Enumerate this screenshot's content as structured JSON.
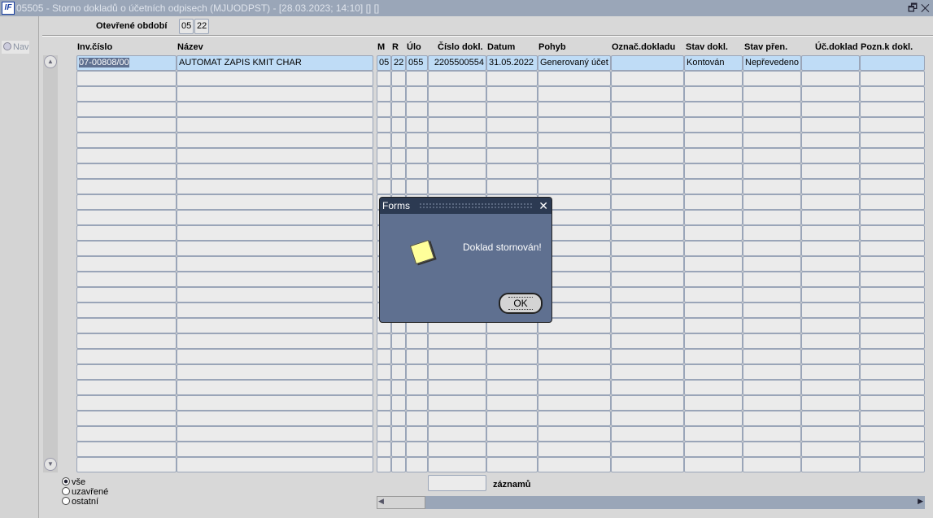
{
  "window": {
    "title": "05505 - Storno dokladů o účetních odpisech (MJUODPST) - [28.03.2023; 14:10] [] []",
    "logo": "IF",
    "restore": "🗗",
    "close": "✕"
  },
  "nav": {
    "label": "Nav"
  },
  "period": {
    "label": "Otevřené období",
    "month": "05",
    "year": "22"
  },
  "columns": [
    "Inv.číslo",
    "Název",
    "M",
    "R",
    "Úlo",
    "Číslo dokl.",
    "Datum",
    "Pohyb",
    "Označ.dokladu",
    "Stav dokl.",
    "Stav přen.",
    "Úč.doklad",
    "Pozn.k dokl."
  ],
  "rows": [
    [
      "07-00808/00",
      "AUTOMAT ZAPIS KMIT CHAR",
      "05",
      "22",
      "055",
      "2205500554",
      "31.05.2022",
      "Generovaný účet",
      "",
      "Kontován",
      "Nepřevedeno",
      "",
      ""
    ]
  ],
  "row_count": 27,
  "filter": {
    "options": [
      "vše",
      "uzavřené",
      "ostatní"
    ],
    "selected": 0
  },
  "records": {
    "value": "",
    "label": "záznamů"
  },
  "dialog": {
    "title": "Forms",
    "message": "Doklad stornován!",
    "ok": "OK",
    "close": "✕"
  }
}
